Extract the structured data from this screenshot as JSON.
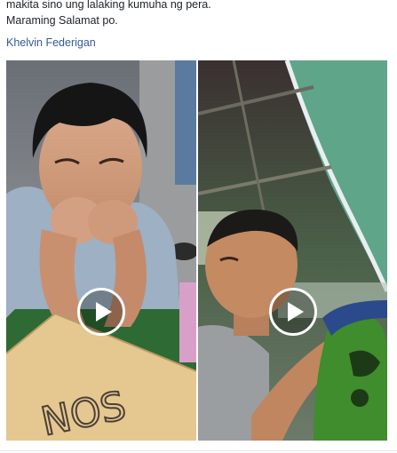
{
  "post": {
    "lines": [
      "makita sino ung lalaking kumuha ng pera.",
      "Maraming Salamat po."
    ],
    "author_link": "Khelvin Federigan"
  },
  "videos": [
    {
      "icon": "play-icon",
      "sign_text": "NOS"
    },
    {
      "icon": "play-icon"
    }
  ]
}
